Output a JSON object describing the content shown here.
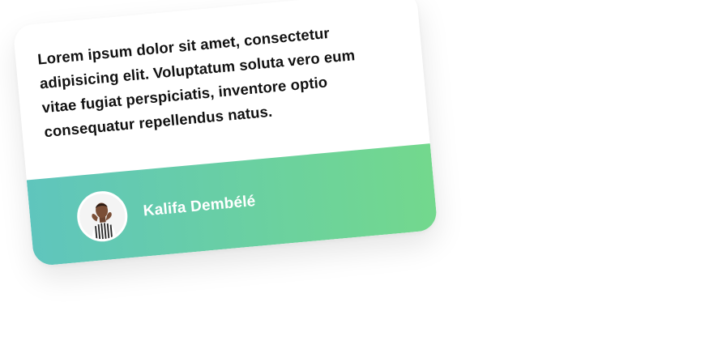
{
  "testimonial": {
    "quote": "Lorem ipsum dolor sit amet, consectetur adipisicing elit. Voluptatum soluta vero eum vitae fugiat perspiciatis, inventore optio consequatur repellendus natus.",
    "author_name": "Kalifa Dembélé",
    "avatar_icon": "person-portrait-icon"
  },
  "colors": {
    "footer_gradient_start": "#5fc5bd",
    "footer_gradient_end": "#73d88d",
    "quote_text": "#111111",
    "author_text": "#ffffff"
  }
}
